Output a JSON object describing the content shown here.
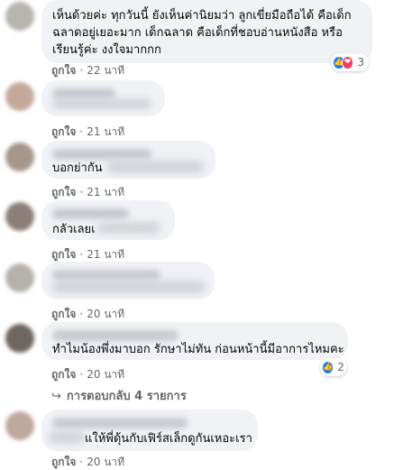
{
  "comments": [
    {
      "lines": [
        "เห็นด้วยค่ะ ทุกวันนี้ ยังเห็นค่านิยมว่า ลูกเขี่ยมือถือได้ คือเด็ก",
        "ฉลาดอยู่เยอะมาก เด็กฉลาด คือเด็กที่ชอบอ่านหนังสือ หรือ",
        "เรียนรู้ค่ะ งงใจมากกก"
      ],
      "like_label": "ถูกใจ",
      "time": "22 นาที",
      "reaction_count": "3",
      "reaction_icons": [
        "like-icon",
        "love-icon"
      ]
    },
    {
      "like_label": "ถูกใจ",
      "time": "21 นาที"
    },
    {
      "text": "บอกย่ากัน",
      "like_label": "ถูกใจ",
      "time": "21 นาที"
    },
    {
      "text": "กลัวเลยเ",
      "like_label": "ถูกใจ",
      "time": "21 นาที"
    },
    {
      "like_label": "ถูกใจ",
      "time": "20 นาที"
    },
    {
      "text": "ทำไมน้องพึ่งมาบอก รักษาไม่ทัน ก่อนหน้านี้มีอาการไหมคะ",
      "like_label": "ถูกใจ",
      "time": "20 นาที",
      "reaction_count": "2",
      "reaction_icons": [
        "like-icon"
      ]
    },
    {
      "text": "แให้พี่ดุ้นกับเฟิร์สเล็กดูกันเหอะเรา",
      "like_label": "ถูกใจ",
      "time": "20 นาที"
    }
  ],
  "replies": {
    "arrow": "↪",
    "label": "การตอบกลับ 4 รายการ"
  },
  "separator": "·",
  "colors": {
    "bubble_bg": "#f0f2f5",
    "meta_text": "#65676b",
    "like_blue": "#1877f2",
    "love_red": "#f33e58"
  }
}
